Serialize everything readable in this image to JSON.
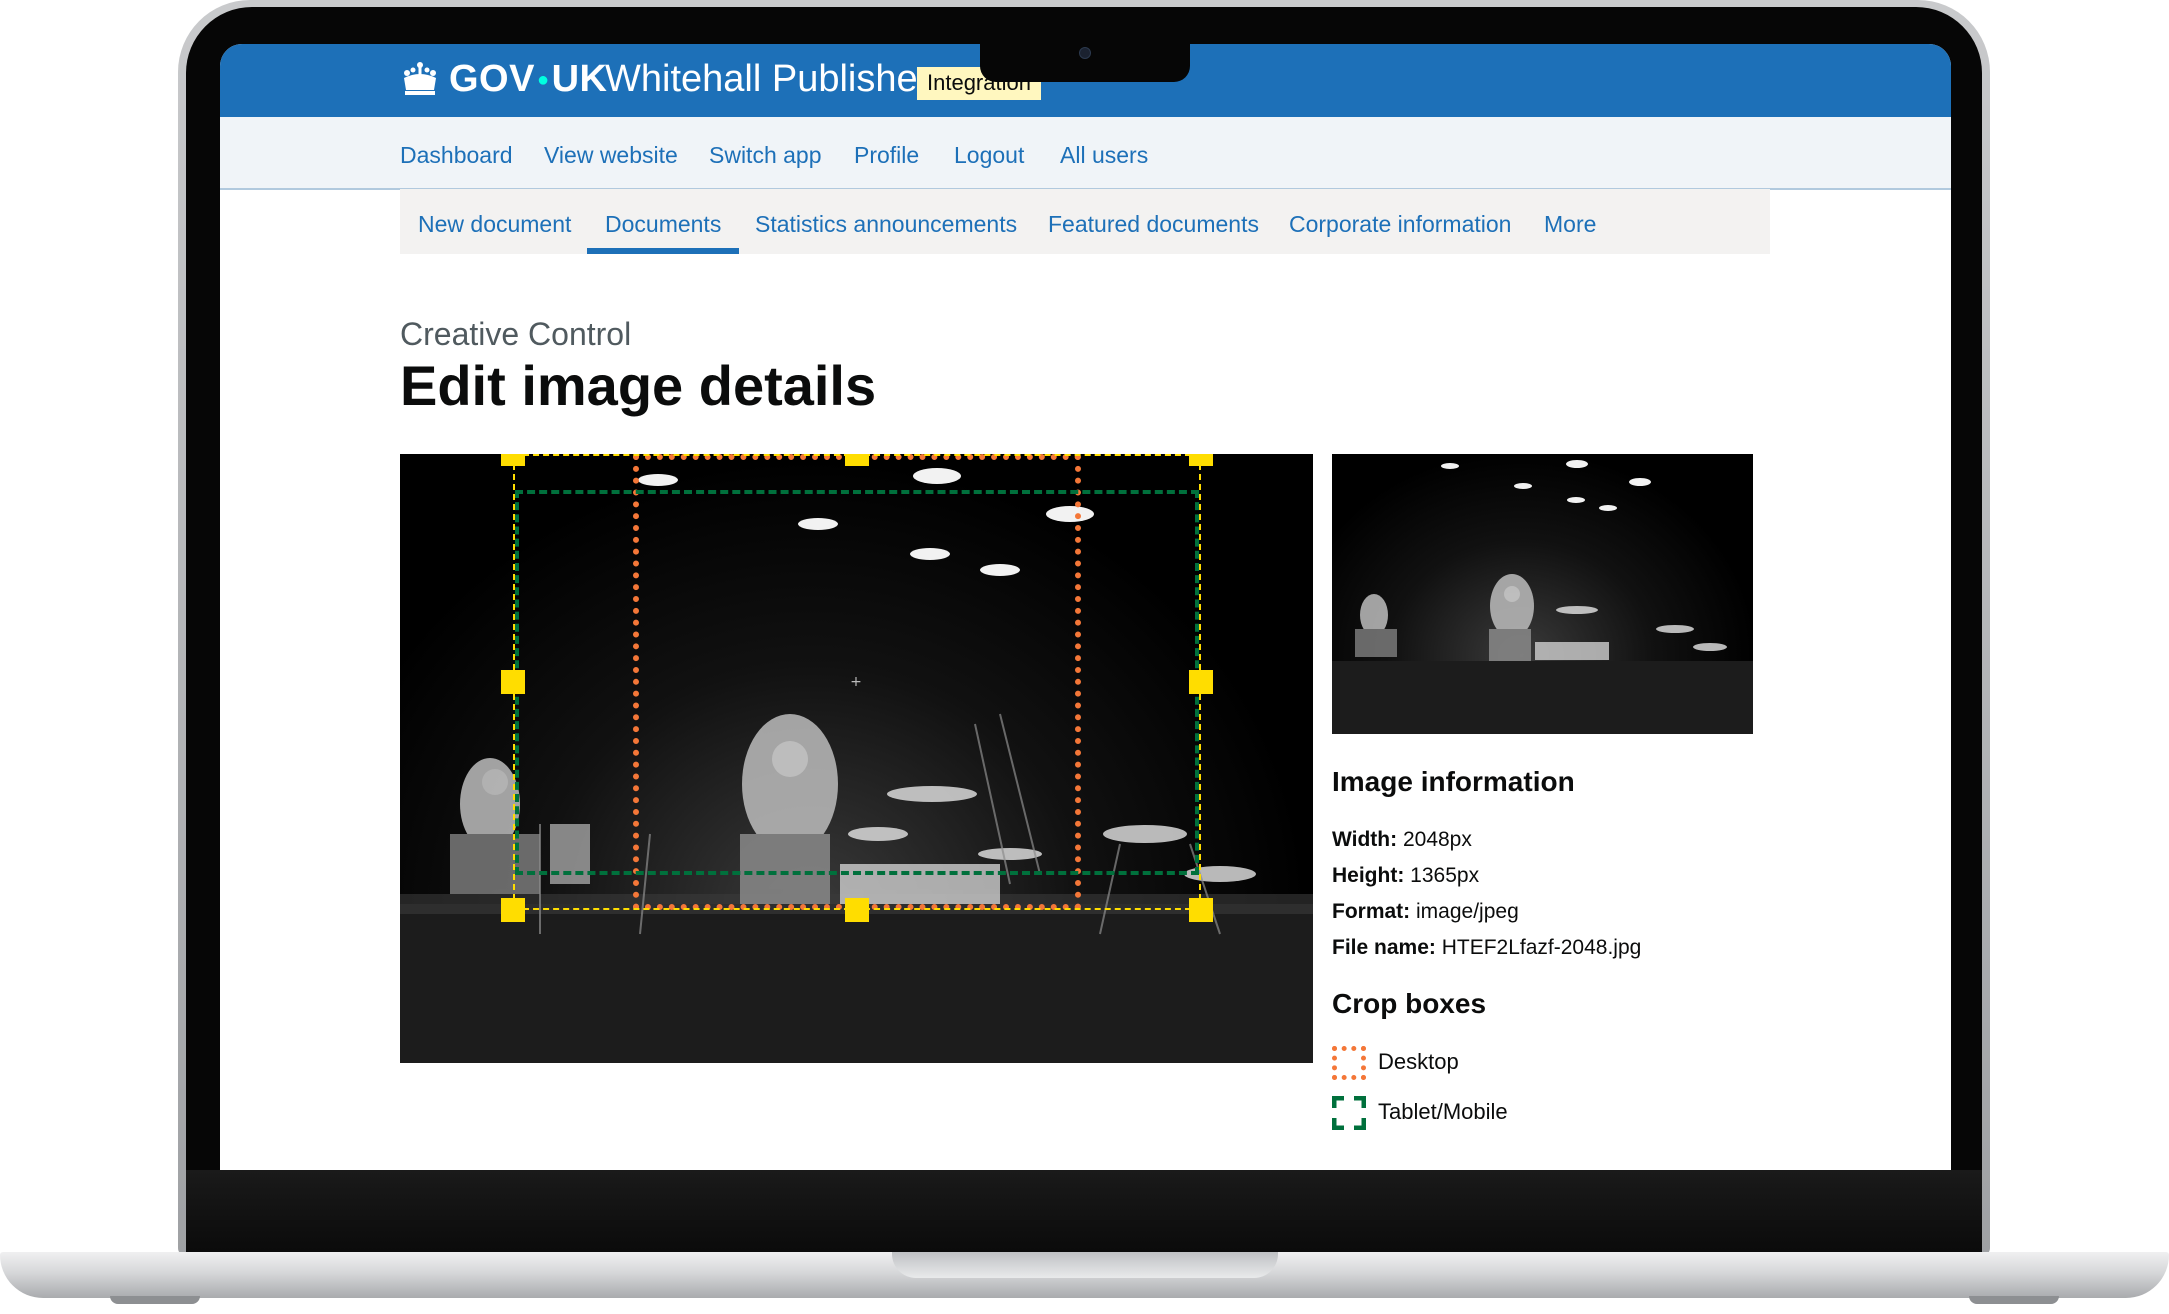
{
  "header": {
    "brand_left": "GOV",
    "brand_right": "UK",
    "app_name": "Whitehall Publisher",
    "environment_tag": "Integration"
  },
  "top_nav": [
    "Dashboard",
    "View website",
    "Switch app",
    "Profile",
    "Logout",
    "All users"
  ],
  "sub_nav": {
    "items": [
      "New document",
      "Documents",
      "Statistics announcements",
      "Featured documents",
      "Corporate information",
      "More"
    ],
    "active": "Documents"
  },
  "page": {
    "caption": "Creative Control",
    "title": "Edit image details"
  },
  "image_information": {
    "heading": "Image information",
    "rows": [
      {
        "label": "Width:",
        "value": "2048px"
      },
      {
        "label": "Height:",
        "value": "1365px"
      },
      {
        "label": "Format:",
        "value": "image/jpeg"
      },
      {
        "label": "File name:",
        "value": "HTEF2Lfazf-2048.jpg"
      }
    ]
  },
  "crop_boxes": {
    "heading": "Crop boxes",
    "items": [
      {
        "label": "Desktop",
        "color": "#f47738",
        "style": "dotted"
      },
      {
        "label": "Tablet/Mobile",
        "color": "#00703c",
        "style": "corners"
      }
    ],
    "selection_color": "#ffdd00"
  },
  "colors": {
    "header_blue": "#1d70b8",
    "link_blue": "#1d70b8",
    "tag_yellow": "#fff7bf"
  },
  "icons": [
    "crown-icon"
  ]
}
